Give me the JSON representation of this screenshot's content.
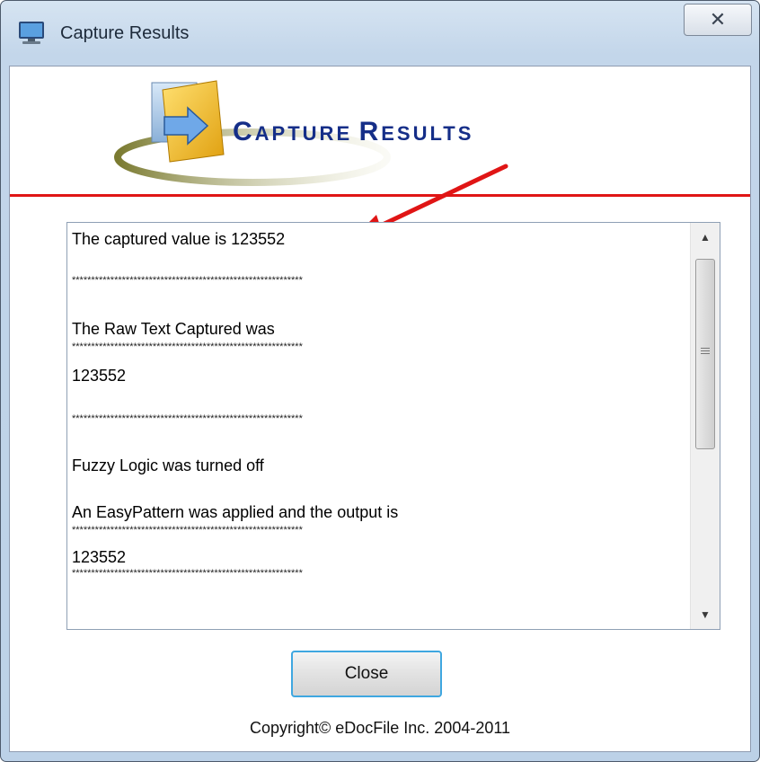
{
  "window": {
    "title": "Capture Results",
    "close_glyph": "✕",
    "icon": "app-monitor-icon"
  },
  "banner": {
    "title_first_initial": "C",
    "title_first_rest": "APTURE",
    "title_second_initial": "R",
    "title_second_rest": "ESULTS",
    "logo_icon": "folder-arrow-logo"
  },
  "annotation": {
    "arrow_color": "#e01515"
  },
  "results": {
    "lines": [
      "The captured value is 123552",
      "************************************************************",
      "The Raw Text Captured was",
      "************************************************************",
      "123552",
      "************************************************************",
      "Fuzzy Logic was turned off",
      "An EasyPattern was applied and the output is",
      "************************************************************",
      "123552",
      "************************************************************"
    ]
  },
  "scrollbar": {
    "up_glyph": "▲",
    "down_glyph": "▼"
  },
  "close_button": {
    "label": "Close"
  },
  "footer": {
    "copyright": "Copyright© eDocFile Inc. 2004-2011"
  },
  "colors": {
    "accent_red": "#e01515",
    "banner_blue": "#152e88",
    "button_focus": "#3fa7e0"
  }
}
